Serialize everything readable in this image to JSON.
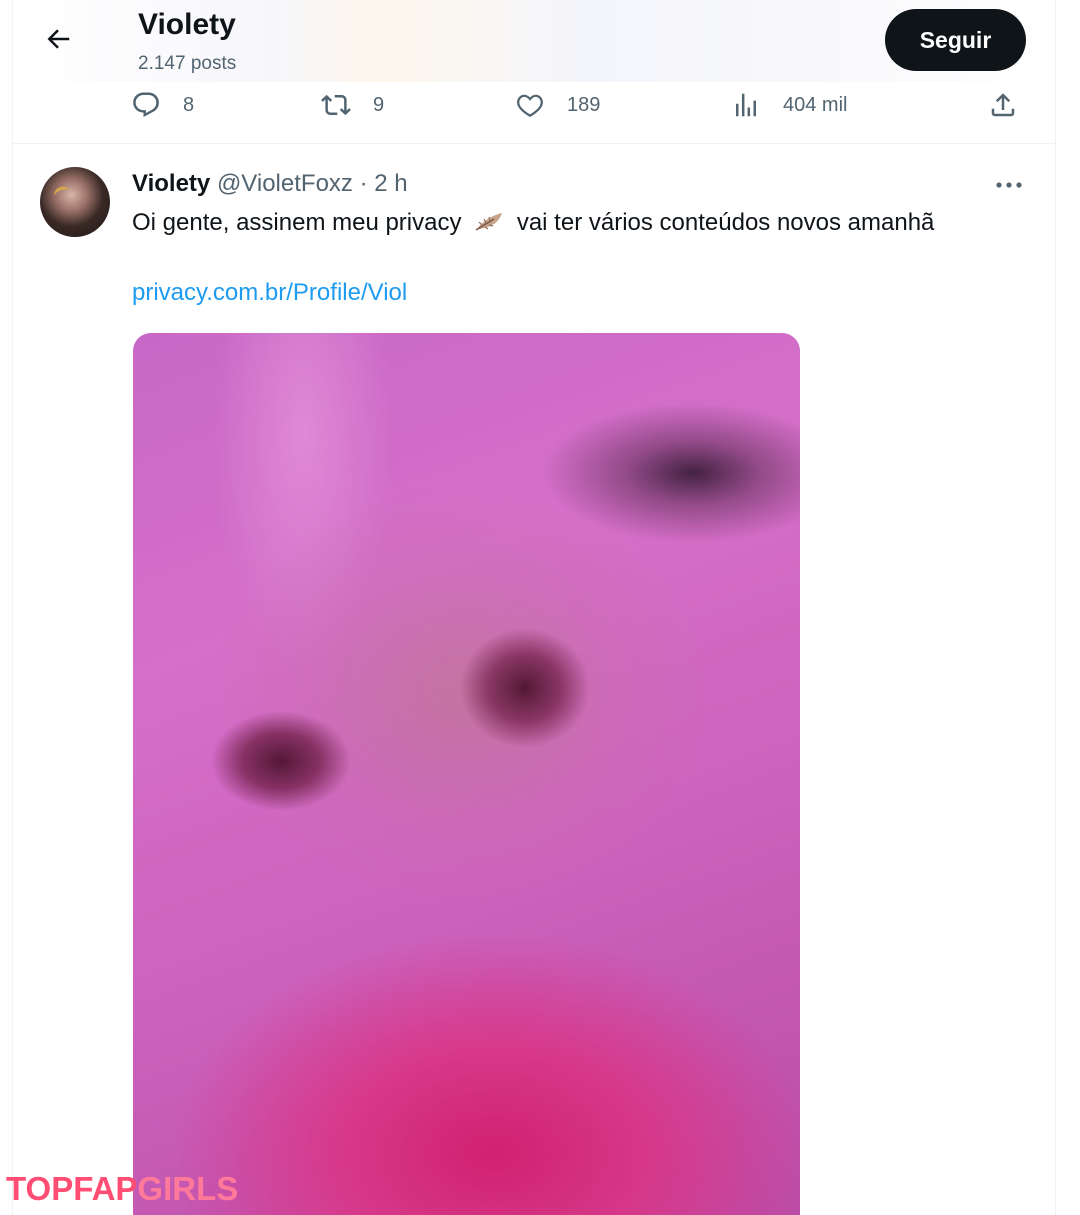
{
  "header": {
    "title": "Violety",
    "subtitle": "2.147 posts",
    "follow_label": "Seguir"
  },
  "actions": {
    "replies": "8",
    "reposts": "9",
    "likes": "189",
    "views": "404 mil"
  },
  "tweet": {
    "name": "Violety",
    "handle": "@VioletFoxz",
    "separator": "·",
    "time": "2 h",
    "text_before_emoji": "Oi gente, assinem meu privacy",
    "text_after_emoji": "vai ter vários conteúdos novos amanhã",
    "link": "privacy.com.br/Profile/Viol"
  },
  "watermark": {
    "part1": "TOPFAP",
    "part2": "GIRLS"
  },
  "icons": {
    "back": "arrow-left-icon",
    "reply": "reply-icon",
    "repost": "repost-icon",
    "like": "heart-icon",
    "views": "views-icon",
    "share": "share-icon",
    "more": "more-icon",
    "emoji": "feather-emoji"
  },
  "colors": {
    "link": "#1d9bf0",
    "text": "#0f1419",
    "muted": "#536471",
    "follow_bg": "#0f1419",
    "watermark": "#ff4d73"
  }
}
